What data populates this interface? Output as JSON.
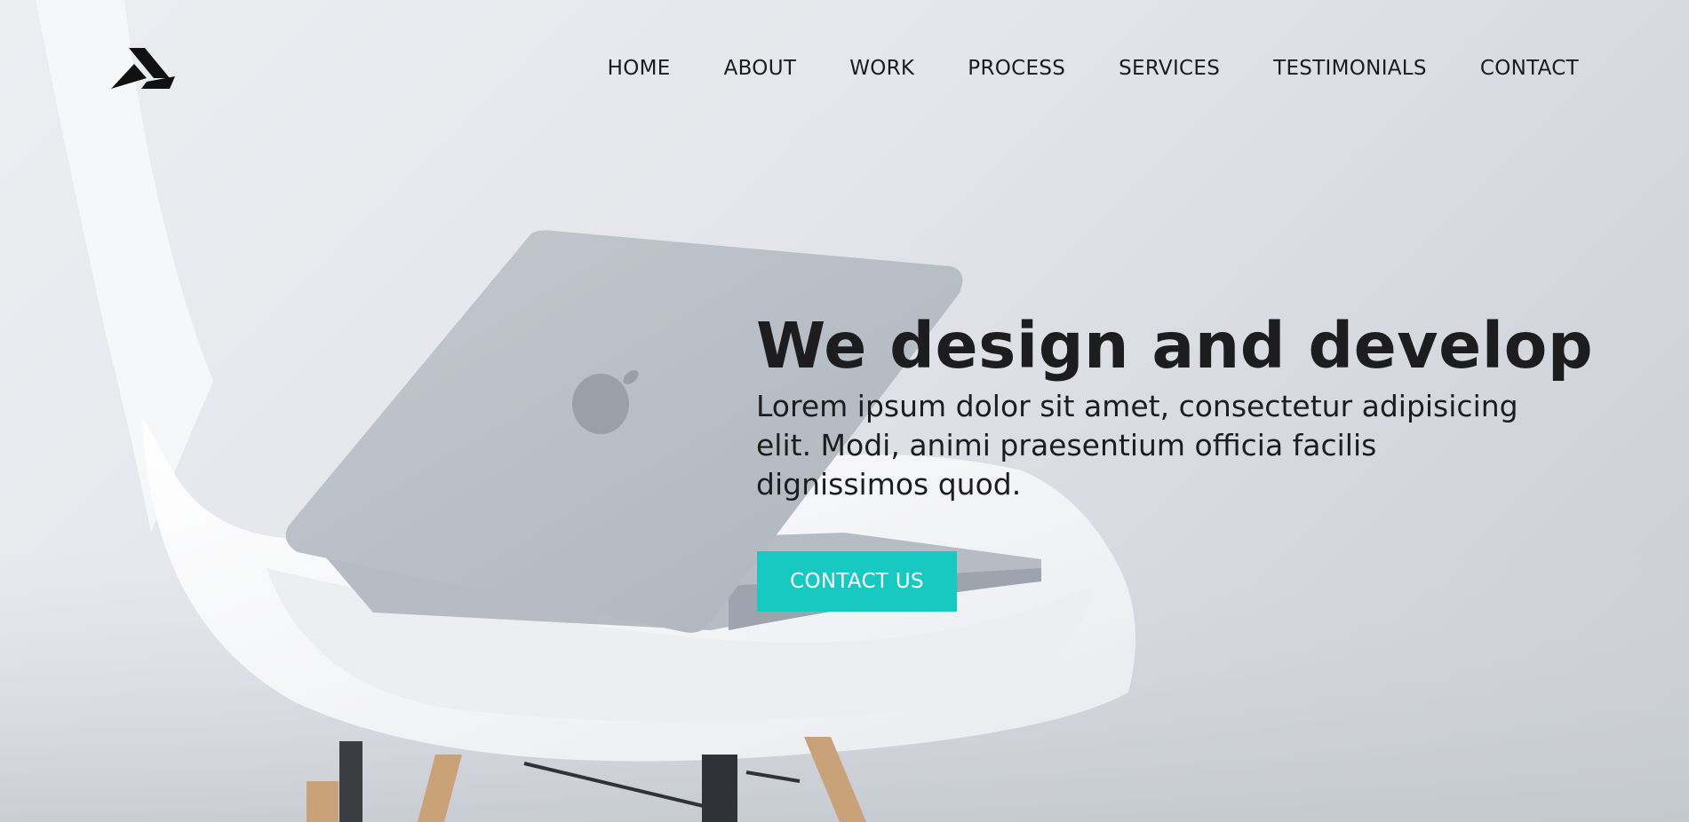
{
  "page": {
    "brand": {
      "logo_icon": "mountain-peak-logo"
    },
    "nav": {
      "items": [
        {
          "label": "HOME"
        },
        {
          "label": "ABOUT"
        },
        {
          "label": "WORK"
        },
        {
          "label": "PROCESS"
        },
        {
          "label": "SERVICES"
        },
        {
          "label": "TESTIMONIALS"
        },
        {
          "label": "CONTACT"
        }
      ]
    },
    "hero": {
      "title": "We design and develop",
      "text": "Lorem ipsum dolor sit amet, consectetur adipisicing elit. Modi, animi praesentium officia facilis dignissimos quod.",
      "cta_label": "CONTACT US"
    },
    "colors": {
      "accent": "#17c9c0",
      "text": "#1d1d1f",
      "background": "#e4e6eb"
    }
  }
}
